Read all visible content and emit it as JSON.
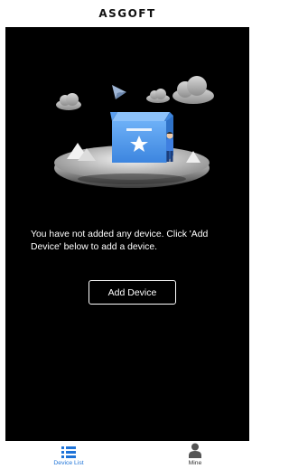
{
  "header": {
    "brand": "ASGOFT"
  },
  "main": {
    "empty_message": "You have not added any device. Click 'Add Device' below to add a device.",
    "add_button_label": "Add Device"
  },
  "nav": {
    "items": [
      {
        "label": "Device List",
        "icon": "list-icon",
        "active": true
      },
      {
        "label": "Mine",
        "icon": "person-icon",
        "active": false
      }
    ]
  },
  "colors": {
    "accent": "#1f74d8",
    "background": "#000000",
    "box": "#5aa0ee"
  }
}
